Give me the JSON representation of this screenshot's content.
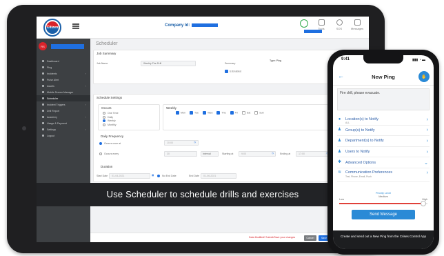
{
  "tablet": {
    "logo_text": "Citizen",
    "company_label": "Company Id:",
    "header_icons": [
      {
        "label": "Tools",
        "icon": "grid-icon"
      },
      {
        "label": "SOS",
        "icon": "sos-icon"
      },
      {
        "label": "Messages",
        "icon": "message-icon"
      }
    ],
    "user_initials": "RS",
    "sidebar": [
      {
        "label": "Dashboard",
        "active": false
      },
      {
        "label": "Ping",
        "active": false
      },
      {
        "label": "Incidents",
        "active": false,
        "arrow": true
      },
      {
        "label": "Pulse Alert",
        "active": false
      },
      {
        "label": "Assets",
        "active": false,
        "arrow": true
      },
      {
        "label": "Mobile Screen Manager",
        "active": false
      },
      {
        "label": "Scheduler",
        "active": true
      },
      {
        "label": "Incident Triggers",
        "active": false,
        "arrow": true
      },
      {
        "label": "Drill Report",
        "active": false
      },
      {
        "label": "Academy",
        "active": false,
        "arrow": true
      },
      {
        "label": "Usage & Payment",
        "active": false
      },
      {
        "label": "Settings",
        "active": false,
        "arrow": true
      },
      {
        "label": "Logout",
        "active": false
      }
    ],
    "page_title": "Scheduler",
    "job_summary": {
      "header": "Job Summary",
      "job_name_label": "Job Name",
      "job_name_value": "Weekly Fire Drill",
      "summary_label": "Summary",
      "summary_value": "Is Enabled",
      "type_label": "Type:",
      "type_value": "Ping"
    },
    "schedule_settings": {
      "header": "Schedule Settings",
      "occurs": {
        "header": "Occurs",
        "options": [
          "One Time",
          "Daily",
          "Weekly",
          "Monthly"
        ],
        "selected": "Weekly"
      },
      "weekly": {
        "header": "Weekly",
        "days": [
          {
            "label": "Mon",
            "checked": true
          },
          {
            "label": "Tue",
            "checked": true
          },
          {
            "label": "Wed",
            "checked": true
          },
          {
            "label": "Thu",
            "checked": true
          },
          {
            "label": "Fri",
            "checked": true
          },
          {
            "label": "Sat",
            "checked": false
          },
          {
            "label": "Sun",
            "checked": false
          }
        ]
      },
      "daily_frequency": {
        "header": "Daily Frequency",
        "option1": "Occurs once at",
        "option1_value": "10:00",
        "option2": "Occurs every",
        "option2_value": "30",
        "interval_unit": "Interval",
        "starting_label": "Starting at",
        "starting_value": "9:00",
        "ending_label": "Ending at",
        "ending_value": "17:00"
      },
      "duration": {
        "header": "Duration",
        "start_label": "Start Date",
        "start_value": "01-04-2021",
        "no_end": "No End Date",
        "end_label": "End Date",
        "end_value": "01-06-2021"
      }
    },
    "footer": {
      "unsaved_note": "Data Modified! Submit/Save your changes",
      "cancel": "Cancel",
      "save": "Save",
      "submit": "Submit"
    },
    "banner_text": "Use Scheduler to schedule drills and exercises"
  },
  "phone": {
    "time": "9:41",
    "status_icons": "▮▮▮ ◔ ▬",
    "back": "←",
    "title": "New Ping",
    "message": "Fire drill, please evacuate.",
    "items": [
      {
        "icon": "location-icon",
        "glyph": "●",
        "label": "Location(s) to Notify",
        "sub": "ALL",
        "trailing": "›"
      },
      {
        "icon": "group-icon",
        "glyph": "♟",
        "label": "Group(s) to Notify",
        "sub": "",
        "trailing": "›"
      },
      {
        "icon": "department-icon",
        "glyph": "♟",
        "label": "Department(s) to Notify",
        "sub": "",
        "trailing": "›"
      },
      {
        "icon": "user-icon",
        "glyph": "♟",
        "label": "Users to Notify",
        "sub": "",
        "trailing": "›"
      },
      {
        "icon": "gear-icon",
        "glyph": "✱",
        "label": "Advanced Options",
        "sub": "",
        "trailing": "⌄"
      },
      {
        "icon": "broadcast-icon",
        "glyph": "≋",
        "label": "Communication Preferences",
        "sub": "Text, Phone, Email, Push",
        "trailing": "›"
      }
    ],
    "priority": {
      "title": "Priority Level",
      "value_label": "Medium",
      "low": "Low",
      "high": "High",
      "level": 0.95
    },
    "send_button": "Send Message",
    "footer_text": "Create and send out a New Ping from the Crises Control App"
  }
}
